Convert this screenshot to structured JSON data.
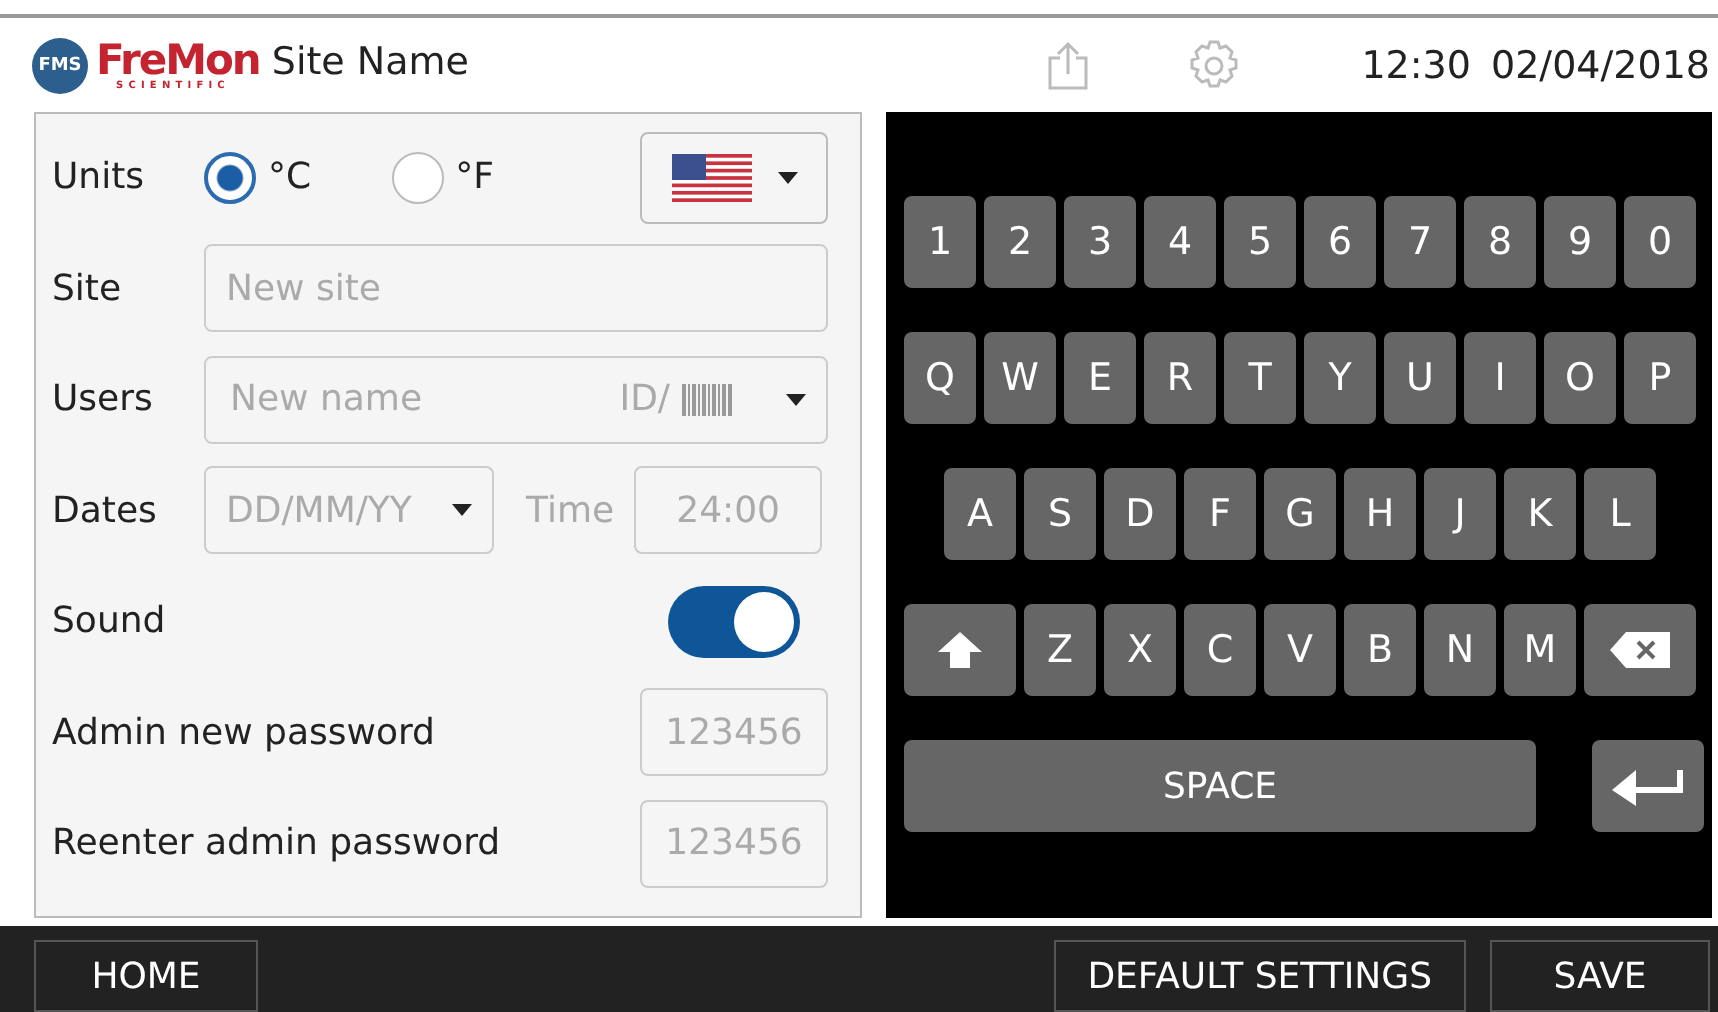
{
  "header": {
    "logo": {
      "badge": "FMS",
      "name": "FreMon",
      "tagline": "SCIENTIFIC"
    },
    "site_name": "Site Name",
    "time": "12:30",
    "date": "02/04/2018"
  },
  "form": {
    "units": {
      "label": "Units",
      "options": [
        {
          "label": "°C",
          "selected": true
        },
        {
          "label": "°F",
          "selected": false
        }
      ]
    },
    "site": {
      "label": "Site",
      "placeholder": "New site"
    },
    "users": {
      "label": "Users",
      "placeholder": "New name",
      "id_label": "ID/"
    },
    "dates": {
      "label": "Dates",
      "value": "DD/MM/YY",
      "time_label": "Time",
      "time_value": "24:00"
    },
    "sound": {
      "label": "Sound",
      "on": true
    },
    "passwords": [
      {
        "label": "Admin new password",
        "placeholder": "123456"
      },
      {
        "label": "Reenter admin password",
        "placeholder": "123456"
      }
    ]
  },
  "keyboard": [
    [
      {
        "kind": "char",
        "label": "1"
      },
      {
        "kind": "char",
        "label": "2"
      },
      {
        "kind": "char",
        "label": "3"
      },
      {
        "kind": "char",
        "label": "4"
      },
      {
        "kind": "char",
        "label": "5"
      },
      {
        "kind": "char",
        "label": "6"
      },
      {
        "kind": "char",
        "label": "7"
      },
      {
        "kind": "char",
        "label": "8"
      },
      {
        "kind": "char",
        "label": "9"
      },
      {
        "kind": "char",
        "label": "0"
      }
    ],
    [
      {
        "kind": "char",
        "label": "Q"
      },
      {
        "kind": "char",
        "label": "W"
      },
      {
        "kind": "char",
        "label": "E"
      },
      {
        "kind": "char",
        "label": "R"
      },
      {
        "kind": "char",
        "label": "T"
      },
      {
        "kind": "char",
        "label": "Y"
      },
      {
        "kind": "char",
        "label": "U"
      },
      {
        "kind": "char",
        "label": "I"
      },
      {
        "kind": "char",
        "label": "O"
      },
      {
        "kind": "char",
        "label": "P"
      }
    ],
    [
      {
        "kind": "char",
        "label": "A"
      },
      {
        "kind": "char",
        "label": "S"
      },
      {
        "kind": "char",
        "label": "D"
      },
      {
        "kind": "char",
        "label": "F"
      },
      {
        "kind": "char",
        "label": "G"
      },
      {
        "kind": "char",
        "label": "H"
      },
      {
        "kind": "char",
        "label": "J"
      },
      {
        "kind": "char",
        "label": "K"
      },
      {
        "kind": "char",
        "label": "L"
      }
    ],
    [
      {
        "kind": "shift"
      },
      {
        "kind": "char",
        "label": "Z"
      },
      {
        "kind": "char",
        "label": "X"
      },
      {
        "kind": "char",
        "label": "C"
      },
      {
        "kind": "char",
        "label": "V"
      },
      {
        "kind": "char",
        "label": "B"
      },
      {
        "kind": "char",
        "label": "N"
      },
      {
        "kind": "char",
        "label": "M"
      },
      {
        "kind": "backspace"
      }
    ],
    [
      {
        "kind": "space",
        "label": "SPACE"
      },
      {
        "kind": "enter"
      }
    ]
  ],
  "footer": {
    "left": [
      "HOME"
    ],
    "right": [
      "DEFAULT SETTINGS",
      "SAVE"
    ]
  }
}
